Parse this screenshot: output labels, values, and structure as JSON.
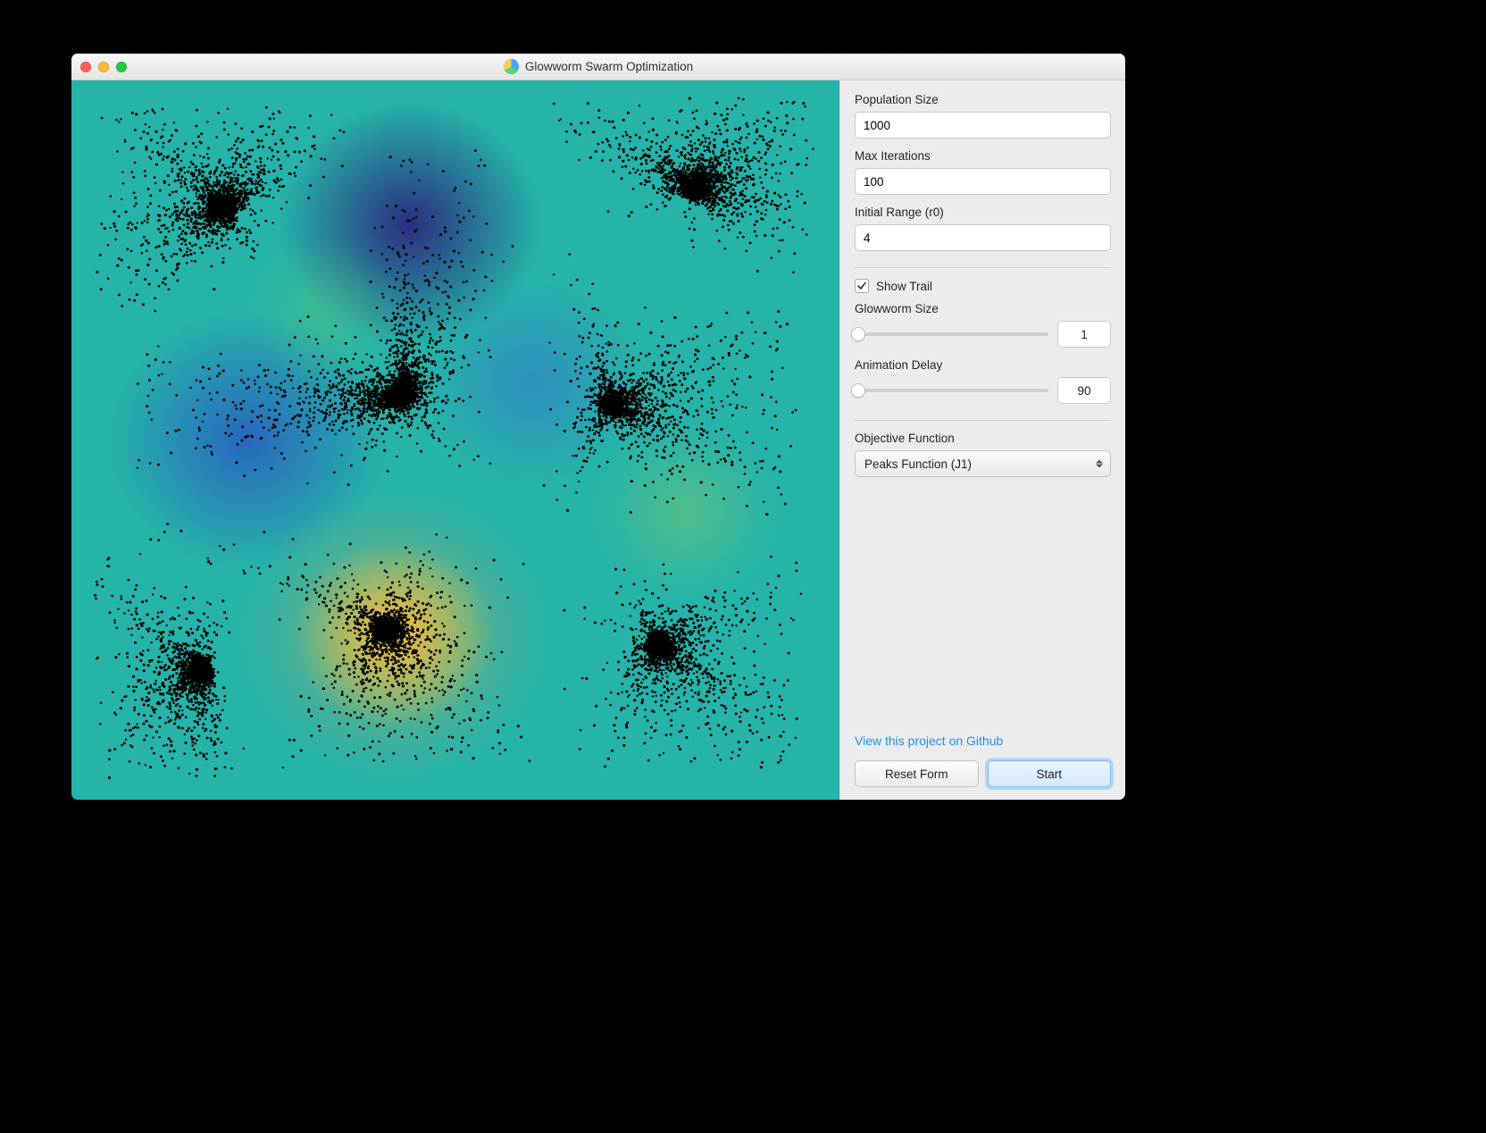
{
  "window": {
    "title": "Glowworm Swarm Optimization"
  },
  "sidebar": {
    "population_label": "Population Size",
    "population_value": "1000",
    "maxiter_label": "Max Iterations",
    "maxiter_value": "100",
    "r0_label": "Initial Range (r0)",
    "r0_value": "4",
    "show_trail_label": "Show Trail",
    "show_trail_checked": true,
    "glowworm_size_label": "Glowworm Size",
    "glowworm_size_value": "1",
    "glowworm_size_pct": 2,
    "anim_delay_label": "Animation Delay",
    "anim_delay_value": "90",
    "anim_delay_pct": 2,
    "objective_label": "Objective Function",
    "objective_selected": "Peaks Function (J1)",
    "github_link": "View this project on Github",
    "reset_label": "Reset Form",
    "start_label": "Start"
  },
  "canvas": {
    "background_color": "#26b3a9",
    "heat_spots": [
      {
        "cx": 0.44,
        "cy": 0.2,
        "r": 0.17,
        "color": "#2b1f7a",
        "opacity": 0.9
      },
      {
        "cx": 0.23,
        "cy": 0.5,
        "r": 0.18,
        "color": "#2947c9",
        "opacity": 0.7
      },
      {
        "cx": 0.6,
        "cy": 0.42,
        "r": 0.14,
        "color": "#3a62d6",
        "opacity": 0.45
      },
      {
        "cx": 0.8,
        "cy": 0.6,
        "r": 0.12,
        "color": "#8fcf5f",
        "opacity": 0.4
      },
      {
        "cx": 0.42,
        "cy": 0.77,
        "r": 0.13,
        "color": "#ffd23a",
        "opacity": 0.95
      },
      {
        "cx": 0.42,
        "cy": 0.77,
        "r": 0.2,
        "color": "#f2a23a",
        "opacity": 0.45
      },
      {
        "cx": 0.33,
        "cy": 0.32,
        "r": 0.1,
        "color": "#6fcf60",
        "opacity": 0.3
      }
    ],
    "attractors": [
      {
        "cx": 0.43,
        "cy": 0.44,
        "weight": 1.0
      },
      {
        "cx": 0.7,
        "cy": 0.45,
        "weight": 0.9
      },
      {
        "cx": 0.41,
        "cy": 0.76,
        "weight": 1.0
      },
      {
        "cx": 0.76,
        "cy": 0.78,
        "weight": 0.7
      },
      {
        "cx": 0.17,
        "cy": 0.82,
        "weight": 0.6
      },
      {
        "cx": 0.2,
        "cy": 0.18,
        "weight": 0.6
      },
      {
        "cx": 0.81,
        "cy": 0.15,
        "weight": 0.6
      }
    ],
    "seed": 714229
  }
}
